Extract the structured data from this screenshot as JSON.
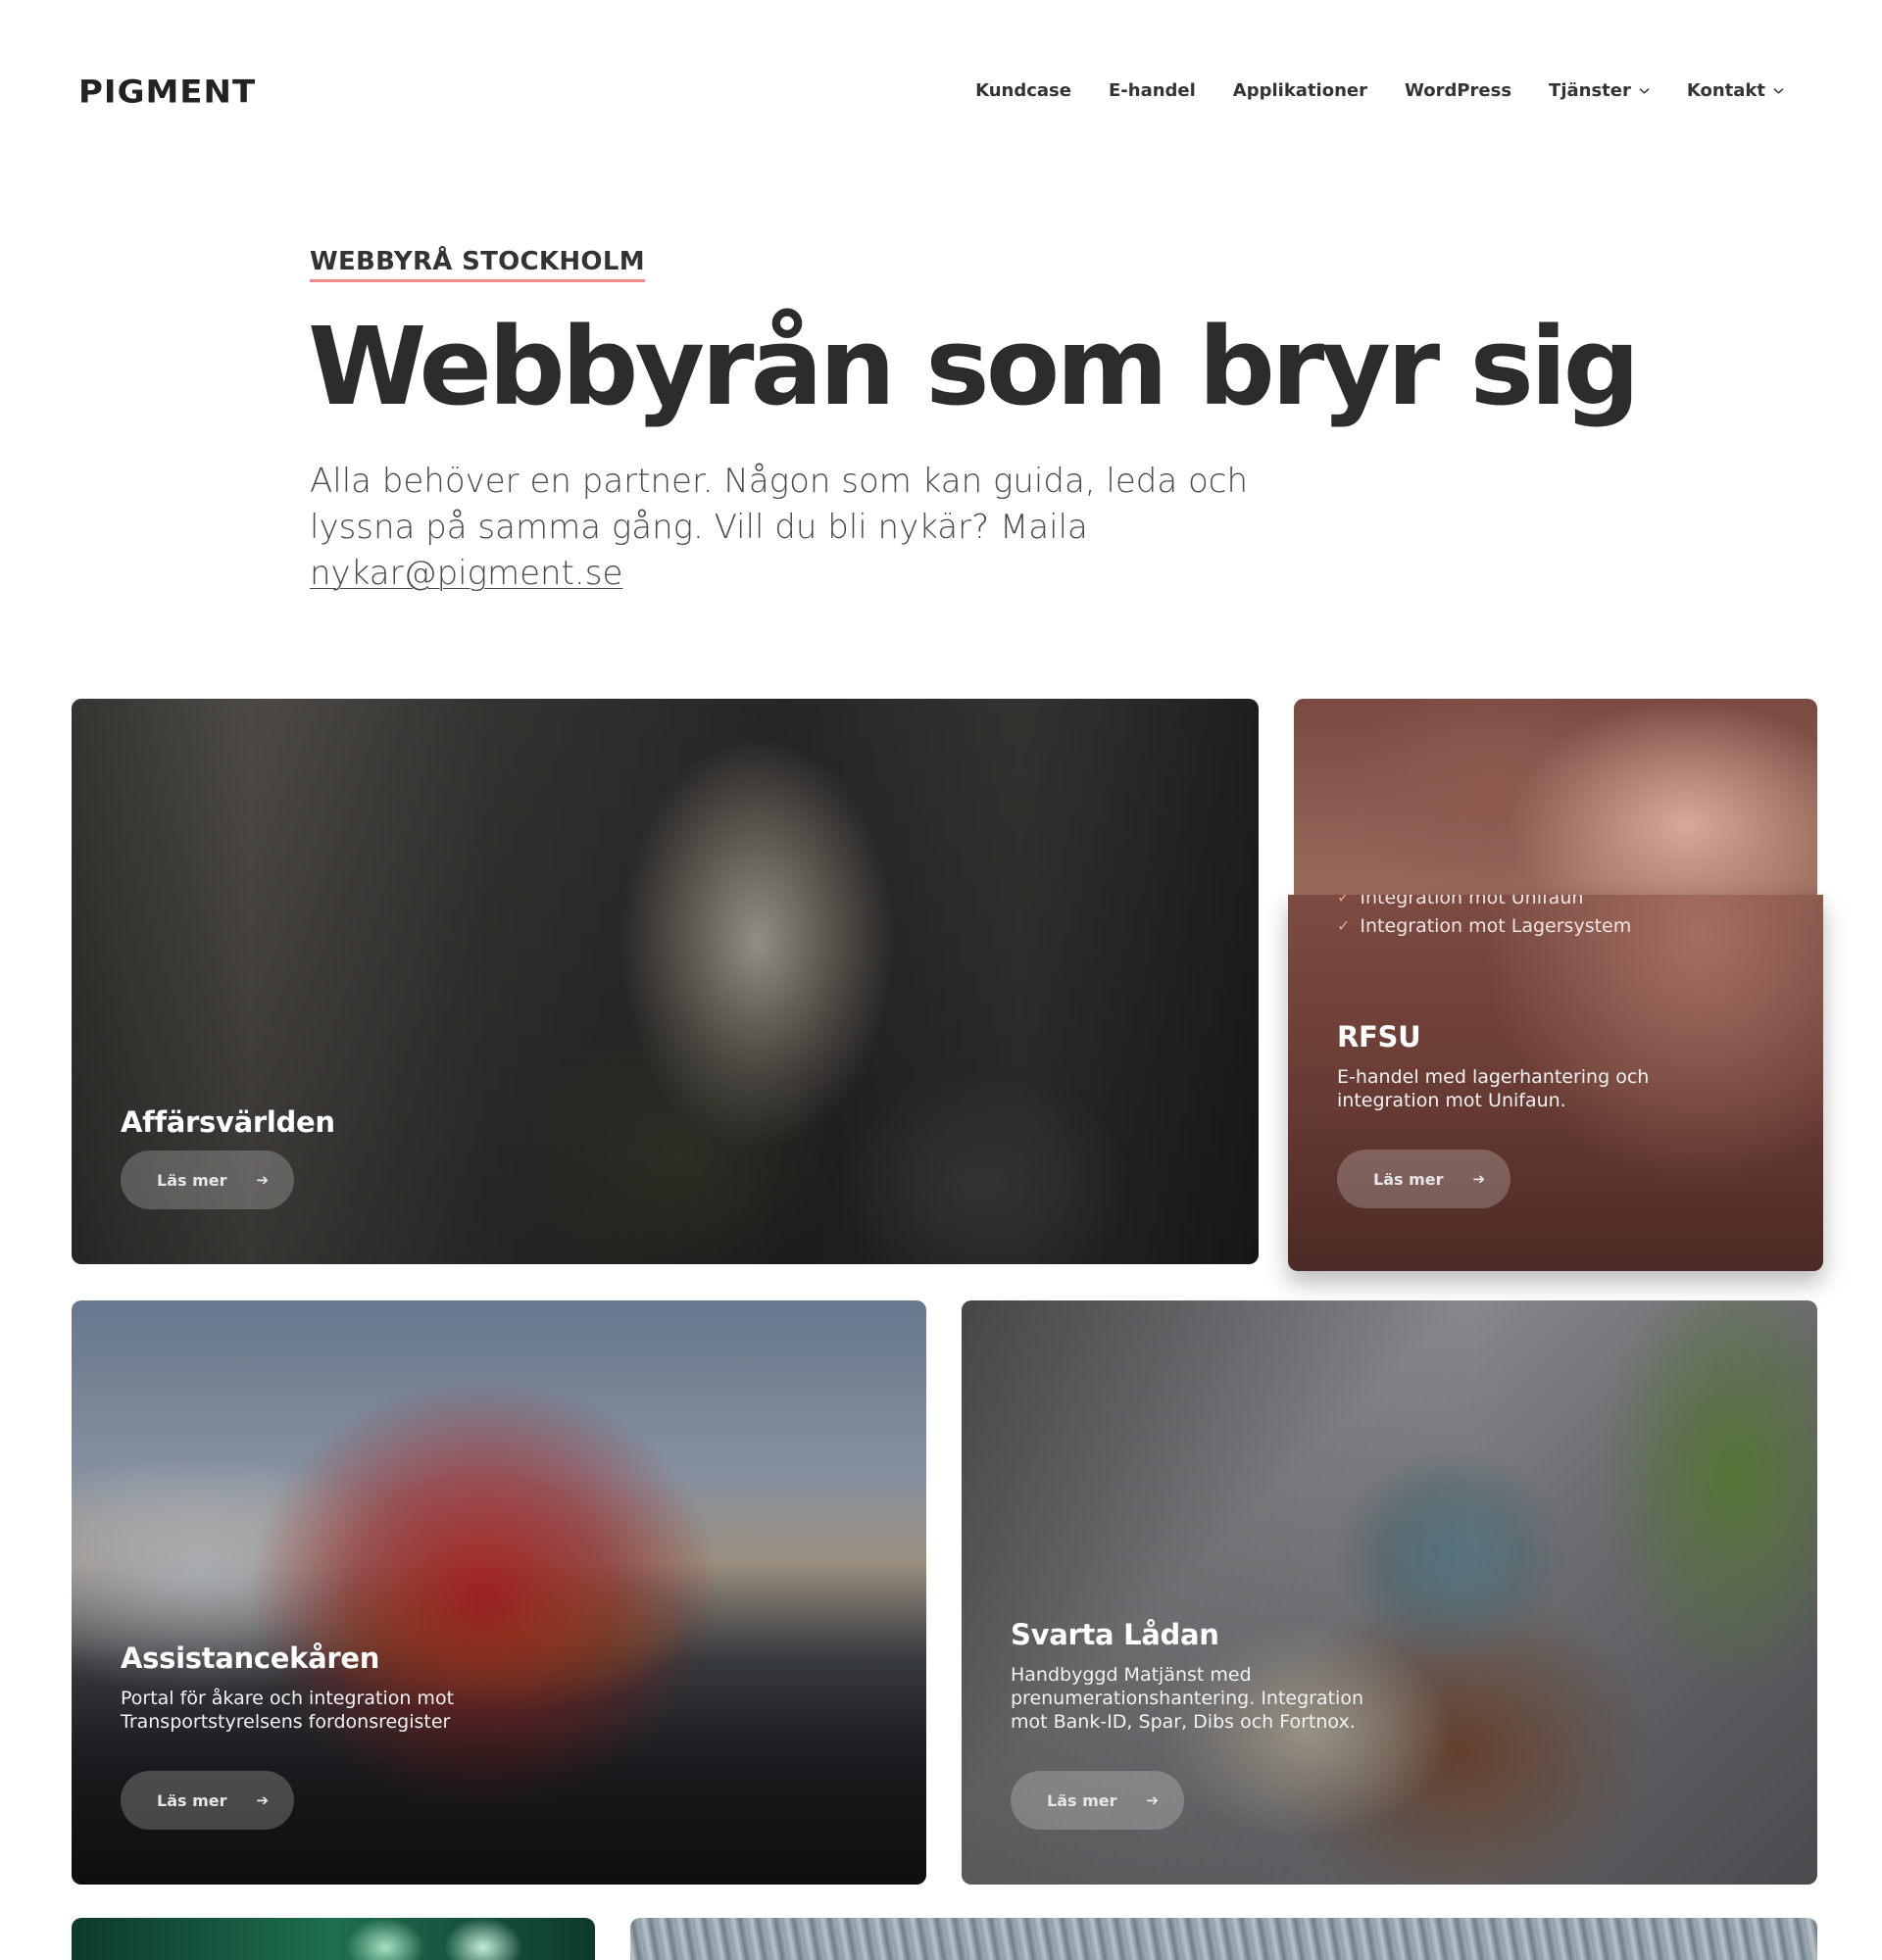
{
  "header": {
    "logo": "PIGMENT",
    "nav": [
      {
        "label": "Kundcase",
        "has_dropdown": false
      },
      {
        "label": "E-handel",
        "has_dropdown": false
      },
      {
        "label": "Applikationer",
        "has_dropdown": false
      },
      {
        "label": "WordPress",
        "has_dropdown": false
      },
      {
        "label": "Tjänster",
        "has_dropdown": true
      },
      {
        "label": "Kontakt",
        "has_dropdown": true
      }
    ]
  },
  "hero": {
    "eyebrow": "WEBBYRÅ STOCKHOLM",
    "title": "Webbyrån som bryr sig",
    "text": "Alla behöver en partner. Någon som kan guida, leda och lyssna på samma gång. Vill du bli nykär? Maila",
    "email": "nykar@pigment.se",
    "accent_color": "#f08b8b"
  },
  "cards": [
    {
      "title": "Affärsvärlden",
      "description": "",
      "button": "Läs mer"
    },
    {
      "title": "RFSU",
      "description": "E-handel med lagerhantering och integration mot Unifaun.",
      "checklist": [
        "Integration mot Unifaun",
        "Integration mot Lagersystem"
      ],
      "button": "Läs mer"
    },
    {
      "title": "Assistancekåren",
      "description": "Portal för åkare och integration mot Transportstyrelsens fordonsregister",
      "button": "Läs mer"
    },
    {
      "title": "Svarta Lådan",
      "description": "Handbyggd Matjänst med prenumerationshantering. Integration mot Bank-ID, Spar, Dibs och Fortnox.",
      "button": "Läs mer"
    }
  ]
}
